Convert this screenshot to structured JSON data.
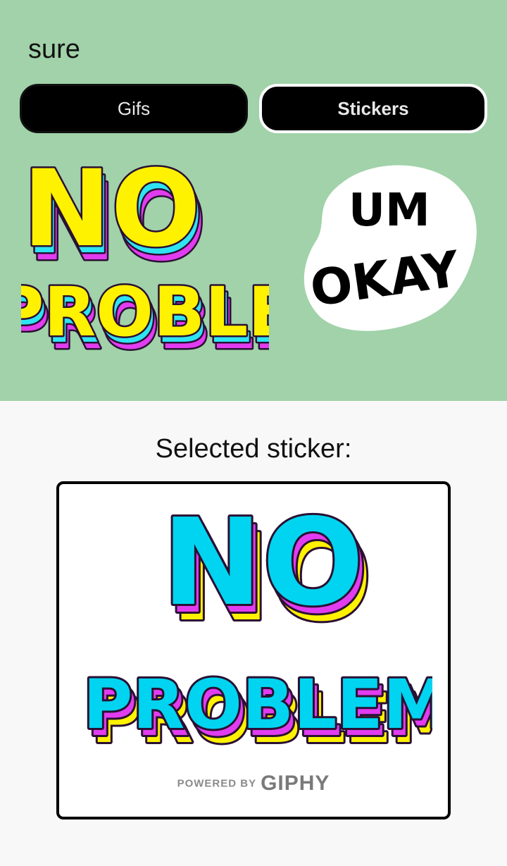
{
  "search": {
    "query": "sure"
  },
  "tabs": [
    {
      "label": "Gifs"
    },
    {
      "label": "Stickers"
    }
  ],
  "results": [
    {
      "lines": [
        "NO",
        "PROBLEM"
      ],
      "colors": [
        "#fff200",
        "#2ee4f2",
        "#e23cf0"
      ]
    },
    {
      "lines": [
        "UM",
        "OKAY"
      ],
      "colors": [
        "#ffffff",
        "#000000"
      ]
    }
  ],
  "selected": {
    "label": "Selected sticker:",
    "sticker_lines": [
      "NO",
      "PROBLEM"
    ],
    "colors": [
      "#00d4f0",
      "#e23cf0",
      "#fff200"
    ],
    "powered_by": "POWERED BY",
    "brand": "GIPHY"
  }
}
